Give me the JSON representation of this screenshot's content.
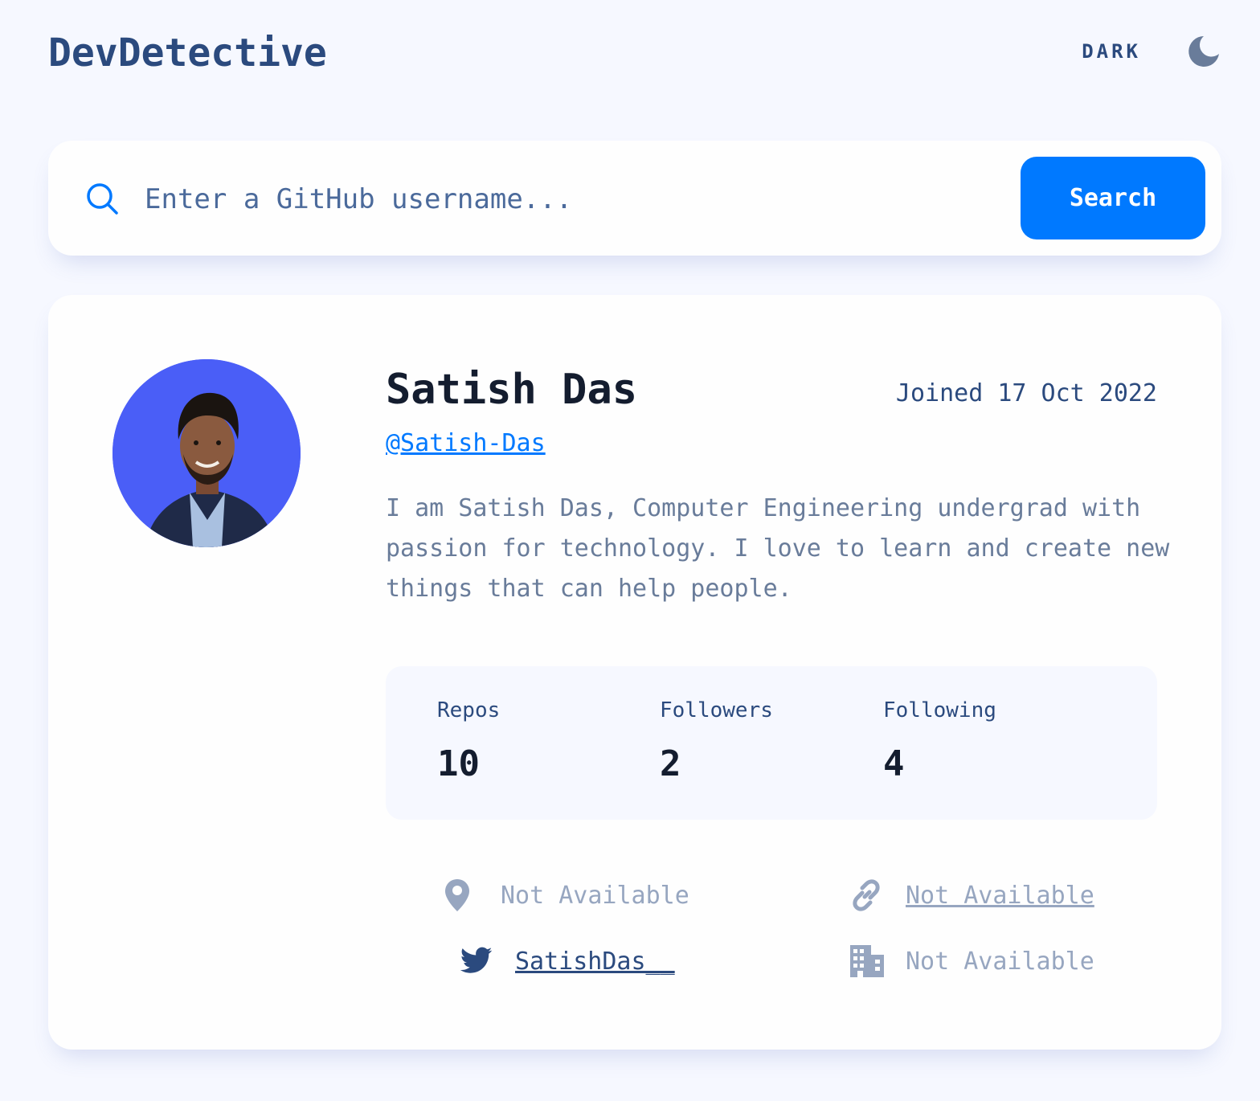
{
  "app": {
    "title": "DevDetective"
  },
  "theme_toggle": {
    "label": "DARK",
    "icon": "moon-icon"
  },
  "search": {
    "placeholder": "Enter a GitHub username...",
    "value": "",
    "button_label": "Search",
    "icon": "search-icon"
  },
  "profile": {
    "name": "Satish Das",
    "joined": "Joined 17 Oct 2022",
    "handle": "@Satish-Das",
    "bio": "I am Satish Das, Computer Engineering undergrad with passion for technology. I love to learn and create new things that can help people.",
    "stats": {
      "repos": {
        "label": "Repos",
        "value": "10"
      },
      "followers": {
        "label": "Followers",
        "value": "2"
      },
      "following": {
        "label": "Following",
        "value": "4"
      }
    },
    "links": {
      "location": {
        "text": "Not Available",
        "icon": "location-pin-icon"
      },
      "website": {
        "text": "Not Available",
        "icon": "link-icon"
      },
      "twitter": {
        "text": "SatishDas__",
        "icon": "twitter-icon"
      },
      "company": {
        "text": "Not Available",
        "icon": "building-icon"
      }
    }
  },
  "colors": {
    "background": "#f6f8ff",
    "card": "#fefefe",
    "accent": "#0079ff",
    "heading": "#2b4a7e",
    "text_muted": "#697c9a",
    "not_available": "#97a6c0",
    "avatar_background": "#4a5ef7"
  }
}
